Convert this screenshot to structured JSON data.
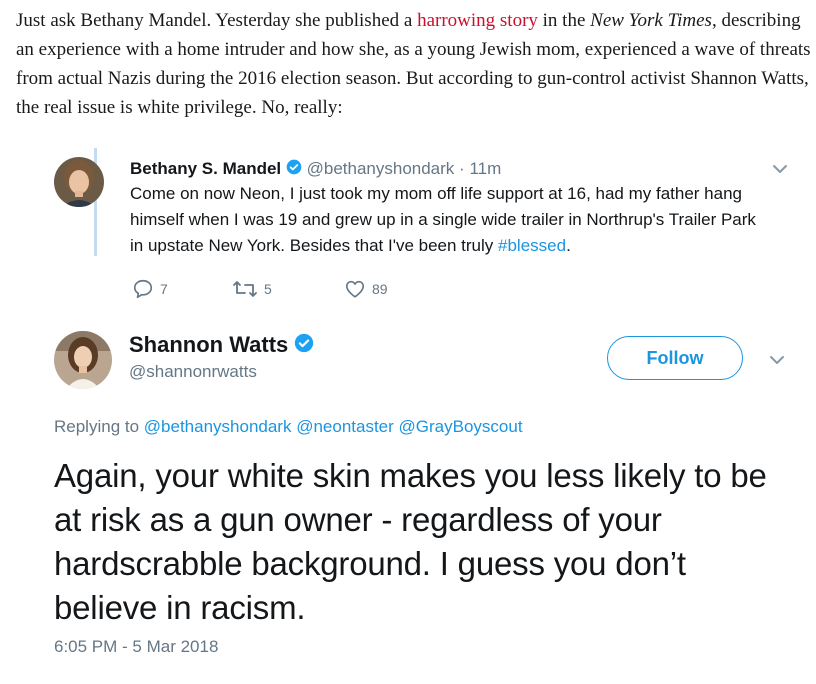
{
  "article": {
    "intro": "Just ask Bethany Mandel. Yesterday she published a ",
    "link_text": "harrowing story",
    "mid": " in the ",
    "publication": "New York Times",
    "rest": ", describing an experience with a home intruder and how she, as a young Jewish mom, experienced a wave of threats from actual Nazis during the 2016 election season. But according to gun-control activist Shannon Watts, the real issue is white privilege. No, really:"
  },
  "reply_tweet": {
    "name": "Bethany S. Mandel",
    "handle": "@bethanyshondark",
    "separator": "·",
    "time": "11m",
    "text": "Come on now Neon, I just took my mom off life support at 16, had my father hang himself when I was 19 and grew up in a single wide trailer in Northrup's Trailer Park in upstate New York. Besides that I've been truly ",
    "hashtag": "#blessed",
    "text_end": ".",
    "replies": "7",
    "retweets": "5",
    "likes": "89",
    "icons": [
      "reply-icon",
      "retweet-icon",
      "heart-icon",
      "verified-icon",
      "chevron-down-icon"
    ]
  },
  "main_tweet": {
    "name": "Shannon Watts",
    "handle": "@shannonrwatts",
    "follow_label": "Follow",
    "replying_prefix": "Replying to ",
    "mentions": [
      "@bethanyshondark",
      "@neontaster",
      "@GrayBoyscout"
    ],
    "text": "Again, your white skin makes you less likely to be at risk as a gun owner - regardless of your hardscrabble background. I guess you don’t believe in racism.",
    "timestamp": "6:05 PM - 5 Mar 2018"
  },
  "colors": {
    "accent": "#1b95e0",
    "link": "#c8102e",
    "muted": "#657786",
    "thread_line": "#c4dcef"
  }
}
